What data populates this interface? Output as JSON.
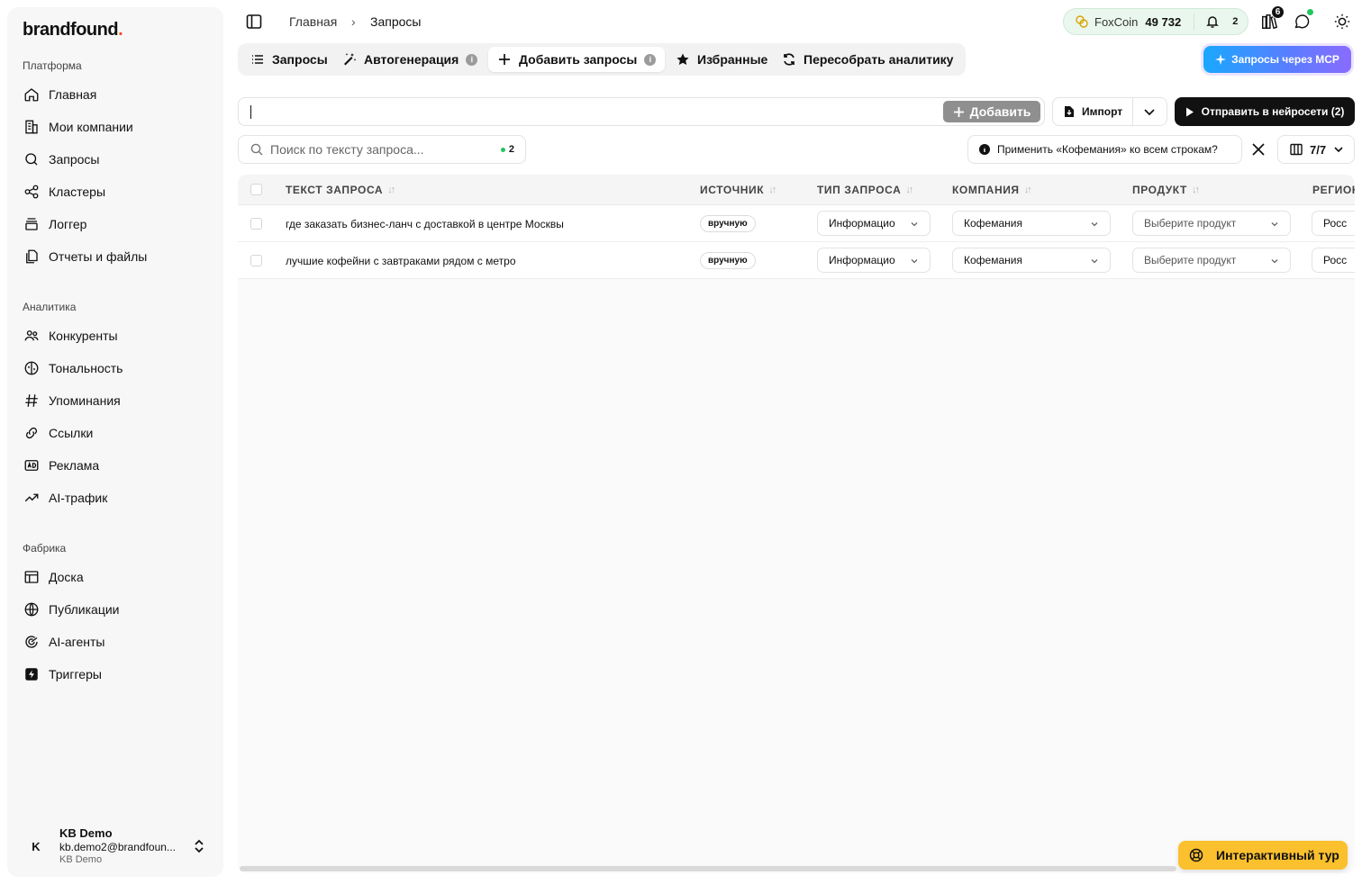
{
  "brand": {
    "name": "brandfound",
    "dot": "."
  },
  "sidebar": {
    "sections": [
      {
        "title": "Платформа",
        "items": [
          {
            "label": "Главная",
            "icon": "home-icon"
          },
          {
            "label": "Мои компании",
            "icon": "building-icon"
          },
          {
            "label": "Запросы",
            "icon": "search-icon"
          },
          {
            "label": "Кластеры",
            "icon": "share-nodes-icon"
          },
          {
            "label": "Логгер",
            "icon": "logger-icon"
          },
          {
            "label": "Отчеты и файлы",
            "icon": "files-icon"
          }
        ]
      },
      {
        "title": "Аналитика",
        "items": [
          {
            "label": "Конкуренты",
            "icon": "users-icon"
          },
          {
            "label": "Тональность",
            "icon": "sentiment-icon"
          },
          {
            "label": "Упоминания",
            "icon": "hash-icon"
          },
          {
            "label": "Ссылки",
            "icon": "link-icon"
          },
          {
            "label": "Реклама",
            "icon": "ad-icon"
          },
          {
            "label": "AI-трафик",
            "icon": "trend-icon"
          }
        ]
      },
      {
        "title": "Фабрика",
        "items": [
          {
            "label": "Доска",
            "icon": "board-icon"
          },
          {
            "label": "Публикации",
            "icon": "globe-icon"
          },
          {
            "label": "AI-агенты",
            "icon": "agent-icon"
          },
          {
            "label": "Триггеры",
            "icon": "bolt-icon"
          }
        ]
      }
    ],
    "user": {
      "initial": "K",
      "name": "KB Demo",
      "email": "kb.demo2@brandfoun...",
      "org": "KB Demo"
    }
  },
  "breadcrumb": {
    "home": "Главная",
    "separator": "›",
    "current": "Запросы"
  },
  "topbar": {
    "coin_label": "FoxCoin",
    "coin_value": "49 732",
    "notifications": "2",
    "sets_badge": "6"
  },
  "tabs": [
    {
      "label": "Запросы",
      "icon": "list-icon"
    },
    {
      "label": "Автогенерация",
      "icon": "magic-wand-icon",
      "info": "i"
    },
    {
      "label": "Добавить запросы",
      "icon": "plus-icon",
      "info": "i",
      "active": true
    },
    {
      "label": "Избранные",
      "icon": "star-icon"
    },
    {
      "label": "Пересобрать аналитику",
      "icon": "refresh-icon"
    }
  ],
  "mcp_button": "Запросы через MCP",
  "add_input": {
    "value": "",
    "button": "Добавить"
  },
  "import_button": "Импорт",
  "send_button": "Отправить в нейросети (2)",
  "search": {
    "placeholder": "Поиск по тексту запроса...",
    "count": "2"
  },
  "apply_prompt": "Применить «Кофемания» ко всем строкам?",
  "columns_button": "7/7",
  "table": {
    "headers": [
      "ТЕКСТ ЗАПРОСА",
      "ИСТОЧНИК",
      "ТИП ЗАПРОСА",
      "КОМПАНИЯ",
      "ПРОДУКТ",
      "РЕГИОН"
    ],
    "rows": [
      {
        "text": "где заказать бизнес-ланч с доставкой в центре Москвы",
        "source": "вручную",
        "type": "Информацио",
        "company": "Кофемания",
        "product": "Выберите продукт",
        "region": "Росс"
      },
      {
        "text": "лучшие кофейни с завтраками рядом с метро",
        "source": "вручную",
        "type": "Информацио",
        "company": "Кофемания",
        "product": "Выберите продукт",
        "region": "Росс"
      }
    ]
  },
  "tour_button": "Интерактивный тур",
  "colors": {
    "accent": "#111111",
    "tour": "#fbc02d",
    "coin_bg": "#eaf7ee",
    "brand_dot": "#f04e23"
  }
}
